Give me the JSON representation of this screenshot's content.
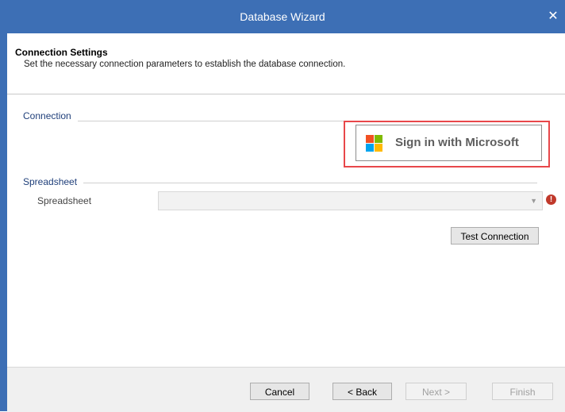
{
  "window": {
    "title": "Database Wizard",
    "close_glyph": "✕"
  },
  "header": {
    "title": "Connection Settings",
    "subtitle": "Set the necessary connection parameters to establish the database connection."
  },
  "connection": {
    "group_label": "Connection",
    "sign_in_label": "Sign in with Microsoft"
  },
  "spreadsheet": {
    "group_label": "Spreadsheet",
    "field_label": "Spreadsheet",
    "selected_value": "",
    "error_glyph": "!"
  },
  "test_connection_label": "Test Connection",
  "footer": {
    "cancel_label": "Cancel",
    "back_label": "< Back",
    "next_label": "Next >",
    "finish_label": "Finish"
  },
  "colors": {
    "title_bar": "#3d6fb5",
    "highlight": "#e8474a",
    "ms_red": "#f25022",
    "ms_green": "#7fba00",
    "ms_blue": "#00a4ef",
    "ms_yellow": "#ffb900"
  }
}
